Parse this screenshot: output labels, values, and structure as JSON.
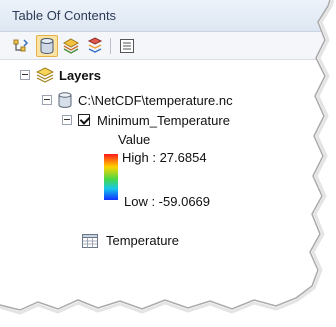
{
  "window": {
    "title": "Table Of Contents"
  },
  "toolbar": {
    "buttons": [
      {
        "icon": "list-by-drawing-order-icon"
      },
      {
        "icon": "list-by-source-icon"
      },
      {
        "icon": "list-by-visibility-icon"
      },
      {
        "icon": "list-by-selection-icon"
      },
      {
        "icon": "options-icon"
      }
    ]
  },
  "tree": {
    "layers_label": "Layers",
    "source_label": "C:\\NetCDF\\temperature.nc",
    "layer_label": "Minimum_Temperature",
    "legend": {
      "field": "Value",
      "high": "High : 27.6854",
      "low": "Low : -59.0669"
    },
    "table_label": "Temperature"
  }
}
